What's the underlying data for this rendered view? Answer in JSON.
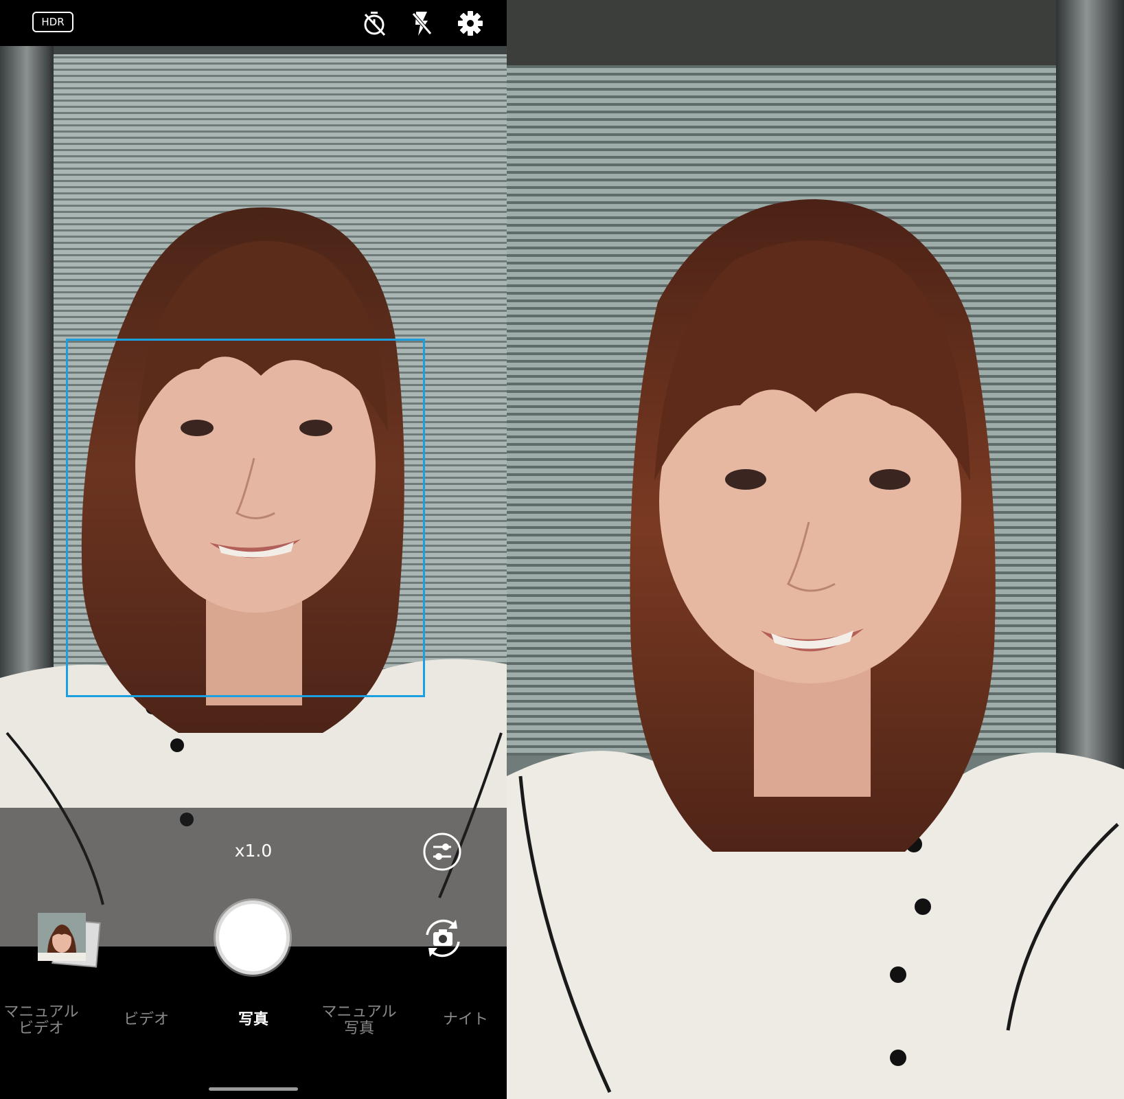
{
  "top_bar": {
    "hdr_label": "HDR",
    "icons": [
      "timer-off-icon",
      "flash-off-icon",
      "settings-gear-icon"
    ]
  },
  "focus": {
    "color": "#1a9fe0"
  },
  "controls": {
    "zoom_label": "x1.0",
    "icons": [
      "adjust-sliders-icon",
      "switch-camera-icon"
    ]
  },
  "modes": [
    {
      "line1": "マニュアル",
      "line2": "ビデオ"
    },
    {
      "line1": "ビデオ",
      "line2": ""
    },
    {
      "line1": "写真",
      "line2": ""
    },
    {
      "line1": "マニュアル",
      "line2": "写真"
    },
    {
      "line1": "ナイト",
      "line2": ""
    }
  ],
  "active_mode": "写真"
}
